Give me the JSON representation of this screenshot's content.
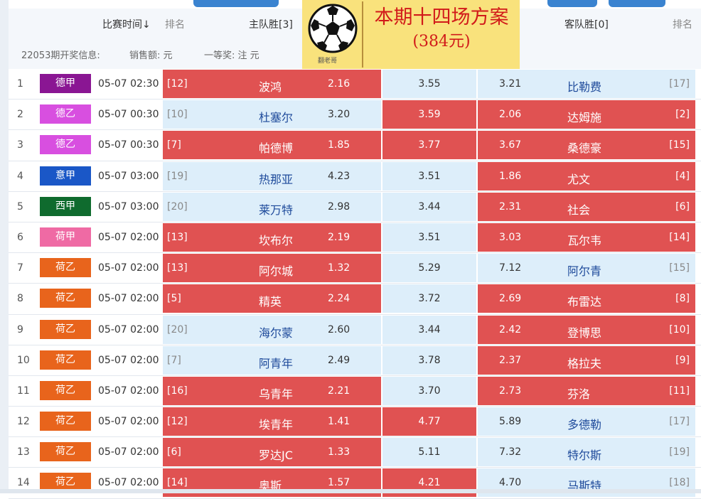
{
  "header": {
    "time_label": "比赛时间↓",
    "rank_left": "排名",
    "home_label": "主队胜[3]",
    "away_label": "客队胜[0]",
    "rank_right": "排名"
  },
  "info": {
    "period": "22053期开奖信息:",
    "sales": "销售额:  元",
    "first_prize": "一等奖:  注  元"
  },
  "promo": {
    "line1": "本期十四场方案",
    "line2": "(384元)",
    "logo_caption": "翻老哥"
  },
  "colors": {
    "odds_highlight": "#e05252",
    "odds_normal": "#ddeefa",
    "promo_bg": "#f9e27c",
    "promo_text": "#d11a1a"
  },
  "matches": [
    {
      "num": "1",
      "league": "德甲",
      "league_color": "#8a1693",
      "time": "05-07 02:30",
      "home_rank": "[12]",
      "home": "波鸿",
      "home_odds": "2.16",
      "draw_odds": "3.55",
      "away_odds": "3.21",
      "away": "比勒费",
      "away_rank": "[17]",
      "home_hl": true,
      "draw_hl": false,
      "away_hl": false
    },
    {
      "num": "2",
      "league": "德乙",
      "league_color": "#d84fe0",
      "time": "05-07 00:30",
      "home_rank": "[10]",
      "home": "杜塞尔",
      "home_odds": "3.20",
      "draw_odds": "3.59",
      "away_odds": "2.06",
      "away": "达姆施",
      "away_rank": "[2]",
      "home_hl": false,
      "draw_hl": true,
      "away_hl": true
    },
    {
      "num": "3",
      "league": "德乙",
      "league_color": "#d84fe0",
      "time": "05-07 00:30",
      "home_rank": "[7]",
      "home": "帕德博",
      "home_odds": "1.85",
      "draw_odds": "3.77",
      "away_odds": "3.67",
      "away": "桑德豪",
      "away_rank": "[15]",
      "home_hl": true,
      "draw_hl": true,
      "away_hl": true
    },
    {
      "num": "4",
      "league": "意甲",
      "league_color": "#1a57c7",
      "time": "05-07 03:00",
      "home_rank": "[19]",
      "home": "热那亚",
      "home_odds": "4.23",
      "draw_odds": "3.51",
      "away_odds": "1.86",
      "away": "尤文",
      "away_rank": "[4]",
      "home_hl": false,
      "draw_hl": false,
      "away_hl": true
    },
    {
      "num": "5",
      "league": "西甲",
      "league_color": "#0f6b2e",
      "time": "05-07 03:00",
      "home_rank": "[20]",
      "home": "莱万特",
      "home_odds": "2.98",
      "draw_odds": "3.44",
      "away_odds": "2.31",
      "away": "社会",
      "away_rank": "[6]",
      "home_hl": false,
      "draw_hl": false,
      "away_hl": true
    },
    {
      "num": "6",
      "league": "荷甲",
      "league_color": "#ef6aa4",
      "time": "05-07 02:00",
      "home_rank": "[13]",
      "home": "坎布尔",
      "home_odds": "2.19",
      "draw_odds": "3.51",
      "away_odds": "3.03",
      "away": "瓦尔韦",
      "away_rank": "[14]",
      "home_hl": true,
      "draw_hl": false,
      "away_hl": true
    },
    {
      "num": "7",
      "league": "荷乙",
      "league_color": "#e8641c",
      "time": "05-07 02:00",
      "home_rank": "[13]",
      "home": "阿尔城",
      "home_odds": "1.32",
      "draw_odds": "5.29",
      "away_odds": "7.12",
      "away": "阿尔青",
      "away_rank": "[15]",
      "home_hl": true,
      "draw_hl": false,
      "away_hl": false
    },
    {
      "num": "8",
      "league": "荷乙",
      "league_color": "#e8641c",
      "time": "05-07 02:00",
      "home_rank": "[5]",
      "home": "精英",
      "home_odds": "2.24",
      "draw_odds": "3.72",
      "away_odds": "2.69",
      "away": "布雷达",
      "away_rank": "[8]",
      "home_hl": true,
      "draw_hl": false,
      "away_hl": true
    },
    {
      "num": "9",
      "league": "荷乙",
      "league_color": "#e8641c",
      "time": "05-07 02:00",
      "home_rank": "[20]",
      "home": "海尔蒙",
      "home_odds": "2.60",
      "draw_odds": "3.44",
      "away_odds": "2.42",
      "away": "登博思",
      "away_rank": "[10]",
      "home_hl": false,
      "draw_hl": false,
      "away_hl": true
    },
    {
      "num": "10",
      "league": "荷乙",
      "league_color": "#e8641c",
      "time": "05-07 02:00",
      "home_rank": "[7]",
      "home": "阿青年",
      "home_odds": "2.49",
      "draw_odds": "3.78",
      "away_odds": "2.37",
      "away": "格拉夫",
      "away_rank": "[9]",
      "home_hl": false,
      "draw_hl": false,
      "away_hl": true
    },
    {
      "num": "11",
      "league": "荷乙",
      "league_color": "#e8641c",
      "time": "05-07 02:00",
      "home_rank": "[16]",
      "home": "乌青年",
      "home_odds": "2.21",
      "draw_odds": "3.70",
      "away_odds": "2.73",
      "away": "芬洛",
      "away_rank": "[11]",
      "home_hl": true,
      "draw_hl": false,
      "away_hl": true
    },
    {
      "num": "12",
      "league": "荷乙",
      "league_color": "#e8641c",
      "time": "05-07 02:00",
      "home_rank": "[12]",
      "home": "埃青年",
      "home_odds": "1.41",
      "draw_odds": "4.77",
      "away_odds": "5.89",
      "away": "多德勒",
      "away_rank": "[17]",
      "home_hl": true,
      "draw_hl": true,
      "away_hl": false
    },
    {
      "num": "13",
      "league": "荷乙",
      "league_color": "#e8641c",
      "time": "05-07 02:00",
      "home_rank": "[6]",
      "home": "罗达JC",
      "home_odds": "1.33",
      "draw_odds": "5.11",
      "away_odds": "7.32",
      "away": "特尔斯",
      "away_rank": "[19]",
      "home_hl": true,
      "draw_hl": false,
      "away_hl": false
    },
    {
      "num": "14",
      "league": "荷乙",
      "league_color": "#e8641c",
      "time": "05-07 02:00",
      "home_rank": "[14]",
      "home": "奥斯",
      "home_odds": "1.57",
      "draw_odds": "4.21",
      "away_odds": "4.70",
      "away": "马斯特",
      "away_rank": "[18]",
      "home_hl": true,
      "draw_hl": true,
      "away_hl": false
    }
  ]
}
